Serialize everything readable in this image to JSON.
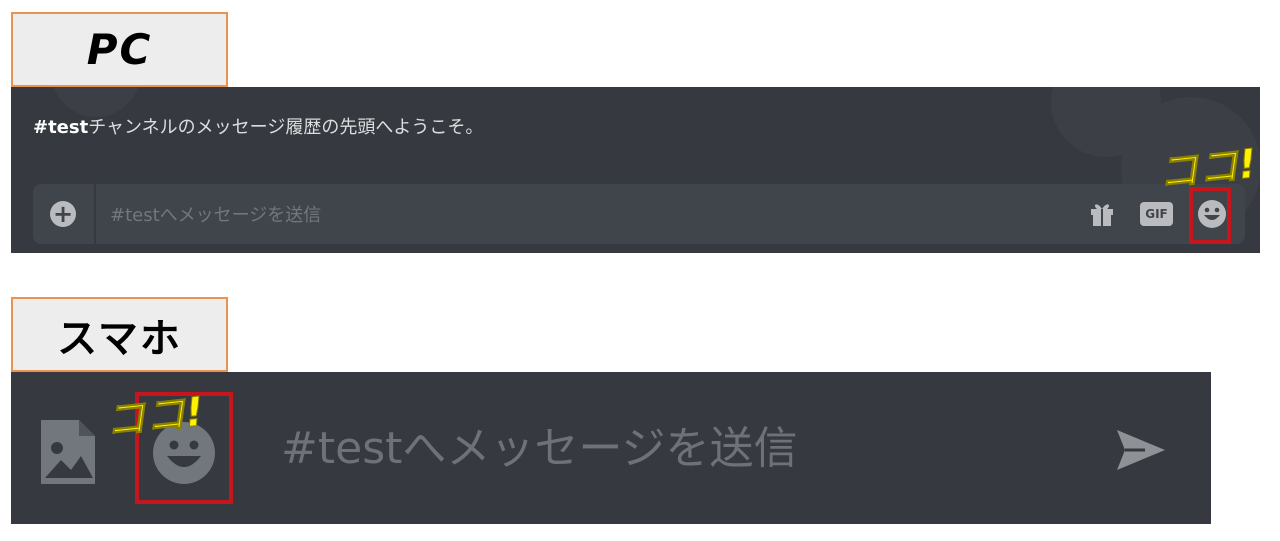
{
  "pc": {
    "label": "PC",
    "welcome_channel": "#test",
    "welcome_rest": "チャンネルのメッセージ履歴の先頭へようこそ。",
    "input_placeholder": "#testへメッセージを送信",
    "gif_label": "GIF",
    "icons": [
      "plus-circle-icon",
      "gift-icon",
      "gif-icon",
      "emoji-icon"
    ],
    "callout": "ココ!"
  },
  "smartphone": {
    "label": "スマホ",
    "input_placeholder": "#testへメッセージを送信",
    "icons": [
      "image-icon",
      "emoji-icon",
      "send-icon"
    ],
    "callout": "ココ!"
  },
  "colors": {
    "panel_bg": "#36393f",
    "input_bg": "#40444b",
    "highlight": "#c4161c",
    "callout": "#fff200",
    "label_border": "#e8944f"
  }
}
